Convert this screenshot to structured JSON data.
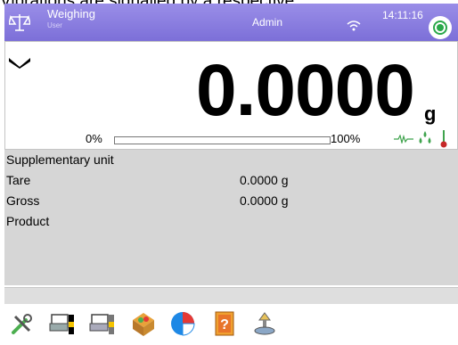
{
  "caption": "Vibrations are signalled by a respective",
  "header": {
    "mode_title": "Weighing",
    "mode_subtitle": "User",
    "user": "Admin",
    "time": "14:11:16",
    "mode_icon": "scale-icon",
    "wifi_icon": "wifi-icon",
    "status_icon": "status-icon"
  },
  "reading": {
    "value": "0.0000",
    "unit": "g",
    "stability_icon": "stable-indicator-icon"
  },
  "bargraph": {
    "min_label": "0%",
    "max_label": "100%",
    "fill_fraction": 0.0
  },
  "indicators": [
    "vibration-icon",
    "drops-icon",
    "thermometer-icon"
  ],
  "info": [
    {
      "label": "Supplementary unit",
      "value": ""
    },
    {
      "label": "Tare",
      "value": "0.0000 g"
    },
    {
      "label": "Gross",
      "value": "0.0000 g"
    },
    {
      "label": "Product",
      "value": ""
    }
  ],
  "toolbar": [
    "tools-icon",
    "tare-printer-icon",
    "tare-printer-2-icon",
    "product-database-icon",
    "pie-chart-icon",
    "help-book-icon",
    "weighing-scale-icon"
  ],
  "colors": {
    "topbar": "#8a7ee0",
    "info_bg": "#d6d6d6",
    "status": "#2aa84a"
  }
}
